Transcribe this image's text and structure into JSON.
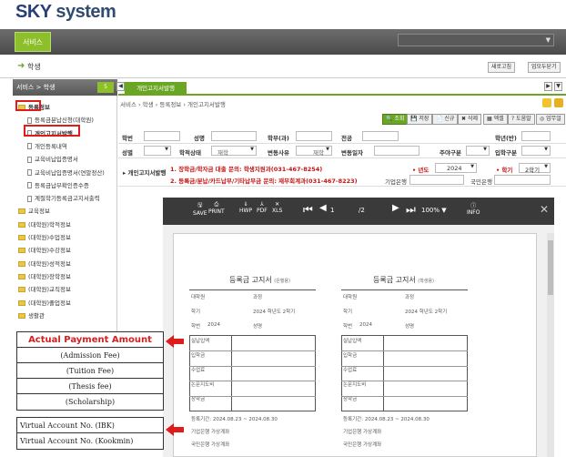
{
  "app": {
    "logo_sky": "SKY",
    "logo_system": "system",
    "menu_service": "서비스"
  },
  "crumb": {
    "title": "학생"
  },
  "top_buttons": {
    "refresh": "새로고침",
    "open_all": "업모두닫기"
  },
  "sidebar": {
    "header": "서비스 > 학생",
    "header_count": "5",
    "items": [
      {
        "label": "등록정보",
        "type": "folder",
        "indent": 0
      },
      {
        "label": "등록금분납신청(대학원)",
        "type": "doc",
        "indent": 1
      },
      {
        "label": "개인고지서발행",
        "type": "doc",
        "indent": 1
      },
      {
        "label": "개인등록내역",
        "type": "doc",
        "indent": 1
      },
      {
        "label": "교육비납입증명서",
        "type": "doc",
        "indent": 1
      },
      {
        "label": "교육비납입증명서(연말정산)",
        "type": "doc",
        "indent": 1
      },
      {
        "label": "등록금납부확인증수증",
        "type": "doc",
        "indent": 1
      },
      {
        "label": "계절학기등록금고지서출력",
        "type": "doc",
        "indent": 1
      },
      {
        "label": "교육정보",
        "type": "folder",
        "indent": 0
      },
      {
        "label": "(대학원)학적정보",
        "type": "folder",
        "indent": 0
      },
      {
        "label": "(대학원)수업정보",
        "type": "folder",
        "indent": 0
      },
      {
        "label": "(대학원)수강정보",
        "type": "folder",
        "indent": 0
      },
      {
        "label": "(대학원)성적정보",
        "type": "folder",
        "indent": 0
      },
      {
        "label": "(대학원)장학정보",
        "type": "folder",
        "indent": 0
      },
      {
        "label": "(대학원)교직정보",
        "type": "folder",
        "indent": 0
      },
      {
        "label": "(대학원)졸업정보",
        "type": "folder",
        "indent": 0
      },
      {
        "label": "생활관",
        "type": "folder",
        "indent": 0
      }
    ]
  },
  "tabs": {
    "active": "개인고지서발행"
  },
  "path": "서비스 › 학생 › 등록정보 › 개인고지서발행",
  "toolbar": {
    "search": "조회",
    "save": "저장",
    "new": "신규",
    "delete": "삭제",
    "print": "엑셀",
    "help": "도움말",
    "manual": "업무얼"
  },
  "form": {
    "row1": {
      "student_no": "학번",
      "name": "성명",
      "dept": "학부(과)",
      "major": "전공",
      "grade": "학년(반)"
    },
    "row2": {
      "gender": "성별",
      "status": "학적상태",
      "status_val": "재학",
      "change": "변동사유",
      "change_val": "재학",
      "change_date": "변동일자",
      "day_night": "주야구분",
      "admission": "입학구분"
    },
    "row3": {
      "label": "개인고지서발행",
      "notice1": "1. 장학금/학자금 대출 문의: 학생지원과(031-467-8254)",
      "notice2": "2. 등록금/분납/카드납부/기타납부금 문의: 재무회계과(031-467-8223)",
      "year_label": "년도",
      "year_val": "2024",
      "semester_label": "학기",
      "semester_val": "2학기",
      "corp_bank": "기업은행",
      "kookmin_bank": "국민은행"
    }
  },
  "viewer": {
    "save": "SAVE",
    "print": "PRINT",
    "hwp": "HWP",
    "pdf": "PDF",
    "xls": "XLS",
    "page_cur": "1",
    "page_total": "/2",
    "zoom": "100%",
    "info": "INFO"
  },
  "slip_left": {
    "title": "등록금 고지서",
    "sub": "(은행용)",
    "rows": [
      "대학원",
      "학기",
      "학번",
      "실납입액",
      "입학금",
      "수업료",
      "논문지도비",
      "장학금"
    ],
    "vals": [
      "과정",
      "2024 학년도 2학기",
      "성명"
    ],
    "year": "2024",
    "period": "등록기간: 2024.08.23 ~ 2024.08.30",
    "acc1": "기업은행 가상계좌",
    "acc2": "국민은행 가상계좌"
  },
  "slip_right": {
    "title": "등록금 고지서",
    "sub": "(학생용)",
    "rows": [
      "대학원",
      "학기",
      "학번",
      "실납입액",
      "입학금",
      "수업료",
      "논문지도비",
      "장학금"
    ],
    "vals": [
      "과정",
      "2024 학년도 2학기",
      "성명"
    ],
    "year": "2024",
    "period": "등록기간: 2024.08.23 ~ 2024.08.30",
    "acc1": "기업은행 가상계좌",
    "acc2": "국민은행 가상계좌"
  },
  "legend": {
    "payment": [
      "Actual Payment Amount",
      "(Admission Fee)",
      "(Tuition Fee)",
      "(Thesis fee)",
      "(Scholarship)"
    ],
    "accounts": [
      "Virtual Account No. (IBK)",
      "Virtual Account No. (Kookmin)"
    ]
  },
  "colors": {
    "accent": "#6aa624",
    "annotation": "#e01b1b"
  }
}
